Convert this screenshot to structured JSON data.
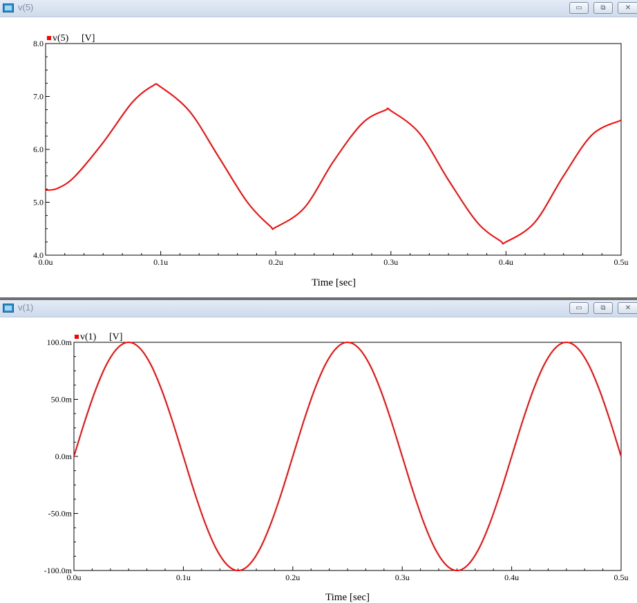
{
  "windows": [
    {
      "title": "v(5)",
      "buttons": {
        "minimize": "▭",
        "restore": "⧉",
        "close": "✕"
      }
    },
    {
      "title": "v(1)",
      "buttons": {
        "minimize": "▭",
        "restore": "⧉",
        "close": "✕"
      }
    }
  ],
  "colors": {
    "trace": "#ff0000",
    "axis": "#000000",
    "titlebar": "#dbe4f0"
  },
  "chart_data": [
    {
      "type": "line",
      "title": "",
      "legend": "v(5)",
      "legend_unit": "[V]",
      "xlabel": "Time [sec]",
      "ylabel": "",
      "xlim": [
        0.0,
        0.5
      ],
      "ylim": [
        4.0,
        8.0
      ],
      "xticks": [
        "0.0u",
        "0.1u",
        "0.2u",
        "0.3u",
        "0.4u",
        "0.5u"
      ],
      "yticks": [
        "8.0",
        "7.0",
        "6.0",
        "5.0",
        "4.0"
      ],
      "grid": false,
      "series": [
        {
          "name": "v(5)",
          "x": [
            0.0,
            0.01,
            0.025,
            0.05,
            0.075,
            0.093,
            0.1,
            0.125,
            0.15,
            0.175,
            0.195,
            0.2,
            0.225,
            0.25,
            0.275,
            0.295,
            0.3,
            0.325,
            0.35,
            0.375,
            0.395,
            0.4,
            0.425,
            0.45,
            0.475,
            0.5
          ],
          "values": [
            5.23,
            5.26,
            5.48,
            6.13,
            6.88,
            7.2,
            7.18,
            6.72,
            5.87,
            5.01,
            4.55,
            4.53,
            4.9,
            5.77,
            6.49,
            6.74,
            6.73,
            6.3,
            5.42,
            4.62,
            4.27,
            4.25,
            4.62,
            5.5,
            6.28,
            6.55
          ]
        }
      ]
    },
    {
      "type": "line",
      "title": "",
      "legend": "v(1)",
      "legend_unit": "[V]",
      "xlabel": "Time [sec]",
      "ylabel": "",
      "xlim": [
        0.0,
        0.5
      ],
      "ylim": [
        -100.0,
        100.0
      ],
      "y_unit": "mV",
      "xticks": [
        "0.0u",
        "0.1u",
        "0.2u",
        "0.3u",
        "0.4u",
        "0.5u"
      ],
      "yticks": [
        "100.0m",
        "50.0m",
        "0.0m",
        "-50.0m",
        "-100.0m"
      ],
      "grid": false,
      "series": [
        {
          "name": "v(1)",
          "x": [
            0.0,
            0.01,
            0.02,
            0.03,
            0.04,
            0.05,
            0.06,
            0.07,
            0.08,
            0.09,
            0.1,
            0.11,
            0.12,
            0.13,
            0.14,
            0.15,
            0.16,
            0.17,
            0.18,
            0.19,
            0.2,
            0.21,
            0.22,
            0.23,
            0.24,
            0.25,
            0.26,
            0.27,
            0.28,
            0.29,
            0.3,
            0.31,
            0.32,
            0.33,
            0.34,
            0.35,
            0.36,
            0.37,
            0.38,
            0.39,
            0.4,
            0.41,
            0.42,
            0.43,
            0.44,
            0.45,
            0.46,
            0.47,
            0.48,
            0.49,
            0.5
          ],
          "values": [
            0,
            30.9,
            58.8,
            80.9,
            95.1,
            100,
            95.1,
            80.9,
            58.8,
            30.9,
            0,
            -30.9,
            -58.8,
            -80.9,
            -95.1,
            -100,
            -95.1,
            -80.9,
            -58.8,
            -30.9,
            0,
            30.9,
            58.8,
            80.9,
            95.1,
            100,
            95.1,
            80.9,
            58.8,
            30.9,
            0,
            -30.9,
            -58.8,
            -80.9,
            -95.1,
            -100,
            -95.1,
            -80.9,
            -58.8,
            -30.9,
            0,
            30.9,
            58.8,
            80.9,
            95.1,
            100,
            95.1,
            80.9,
            58.8,
            30.9,
            0
          ]
        }
      ]
    }
  ]
}
